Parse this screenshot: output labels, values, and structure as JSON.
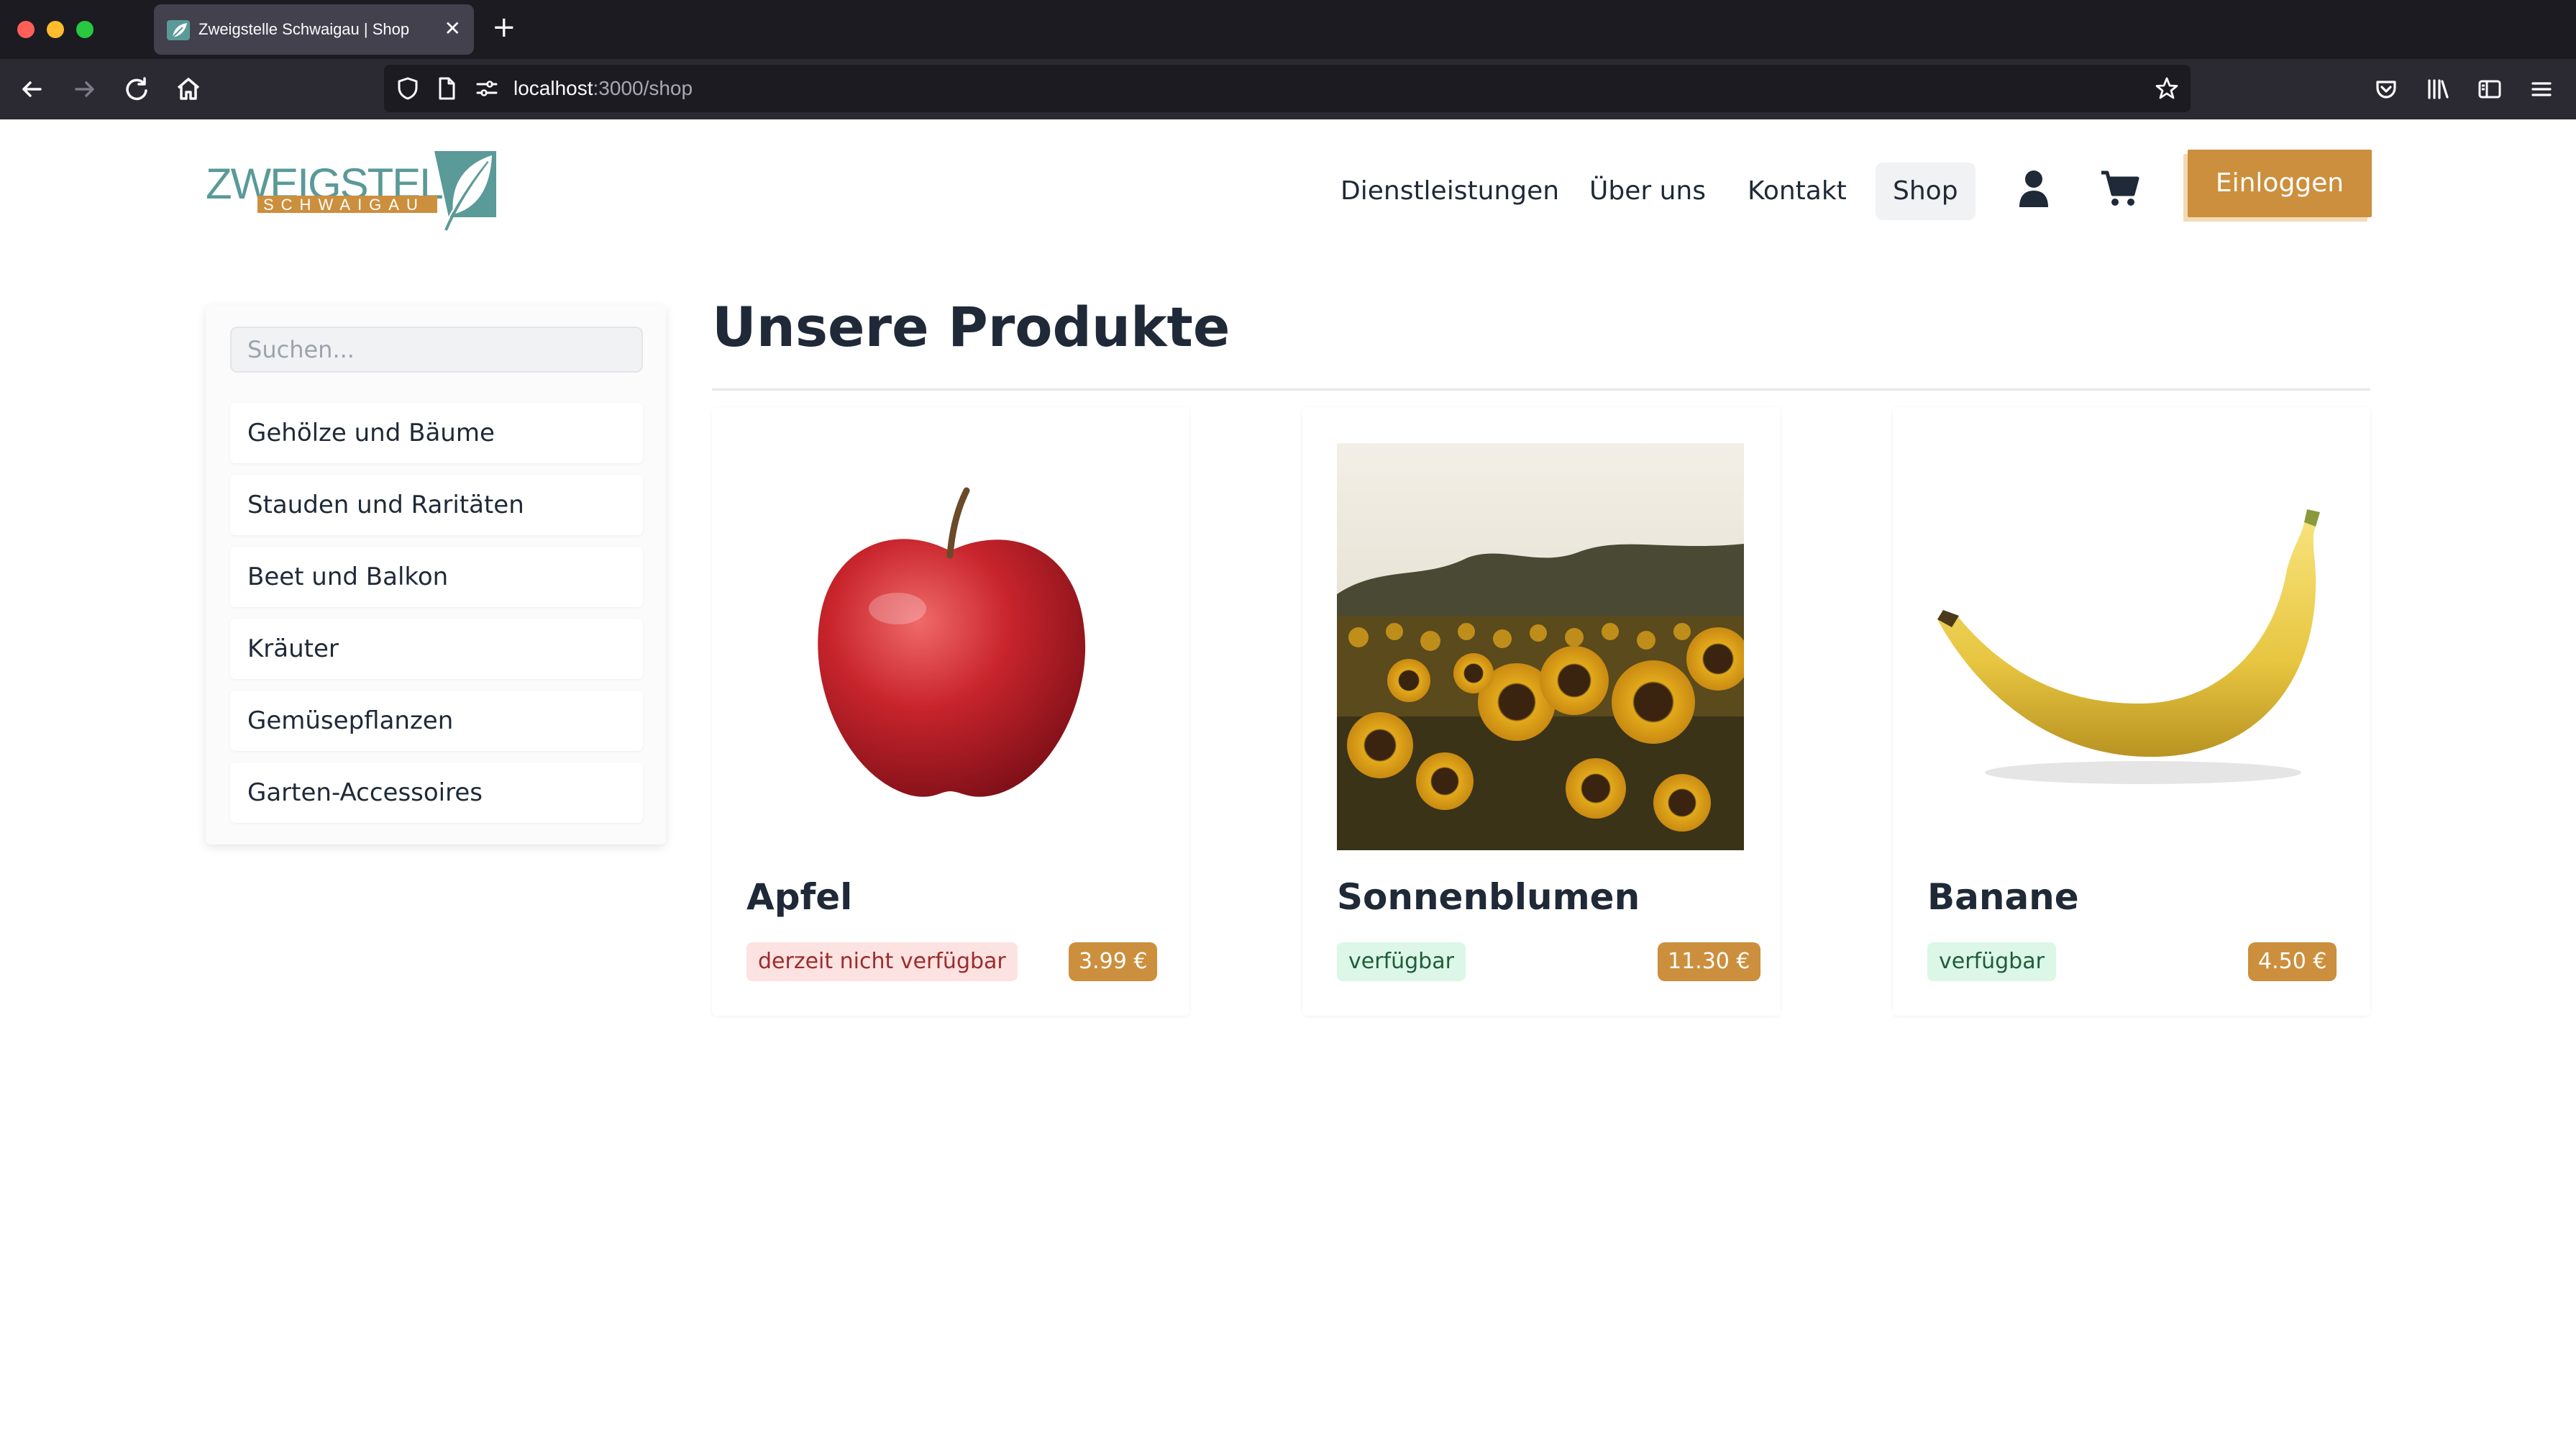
{
  "browser": {
    "tab_title": "Zweigstelle Schwaigau | Shop",
    "url_host": "localhost",
    "url_path": ":3000/shop"
  },
  "header": {
    "logo_text_top": "ZWEIGSTELLE",
    "logo_text_bottom": "SCHWAIGAU",
    "menu": [
      "Dienstleistungen",
      "Über uns",
      "Kontakt",
      "Shop"
    ],
    "active_menu": "Shop",
    "login_label": "Einloggen"
  },
  "sidebar": {
    "search_placeholder": "Suchen...",
    "categories": [
      "Gehölze und Bäume",
      "Stauden und Raritäten",
      "Beet und Balkon",
      "Kräuter",
      "Gemüsepflanzen",
      "Garten-Accessoires"
    ]
  },
  "main": {
    "title": "Unsere Produkte",
    "products": [
      {
        "name": "Apfel",
        "availability": "derzeit nicht verfügbar",
        "available": false,
        "price": "3.99 €"
      },
      {
        "name": "Sonnenblumen",
        "availability": "verfügbar",
        "available": true,
        "price": "11.30 €"
      },
      {
        "name": "Banane",
        "availability": "verfügbar",
        "available": true,
        "price": "4.50 €"
      }
    ]
  },
  "colors": {
    "accent": "#cc8f3d",
    "logo_teal": "#5a9a98",
    "unavailable_bg": "#fde2e2",
    "available_bg": "#dcf7e7"
  }
}
